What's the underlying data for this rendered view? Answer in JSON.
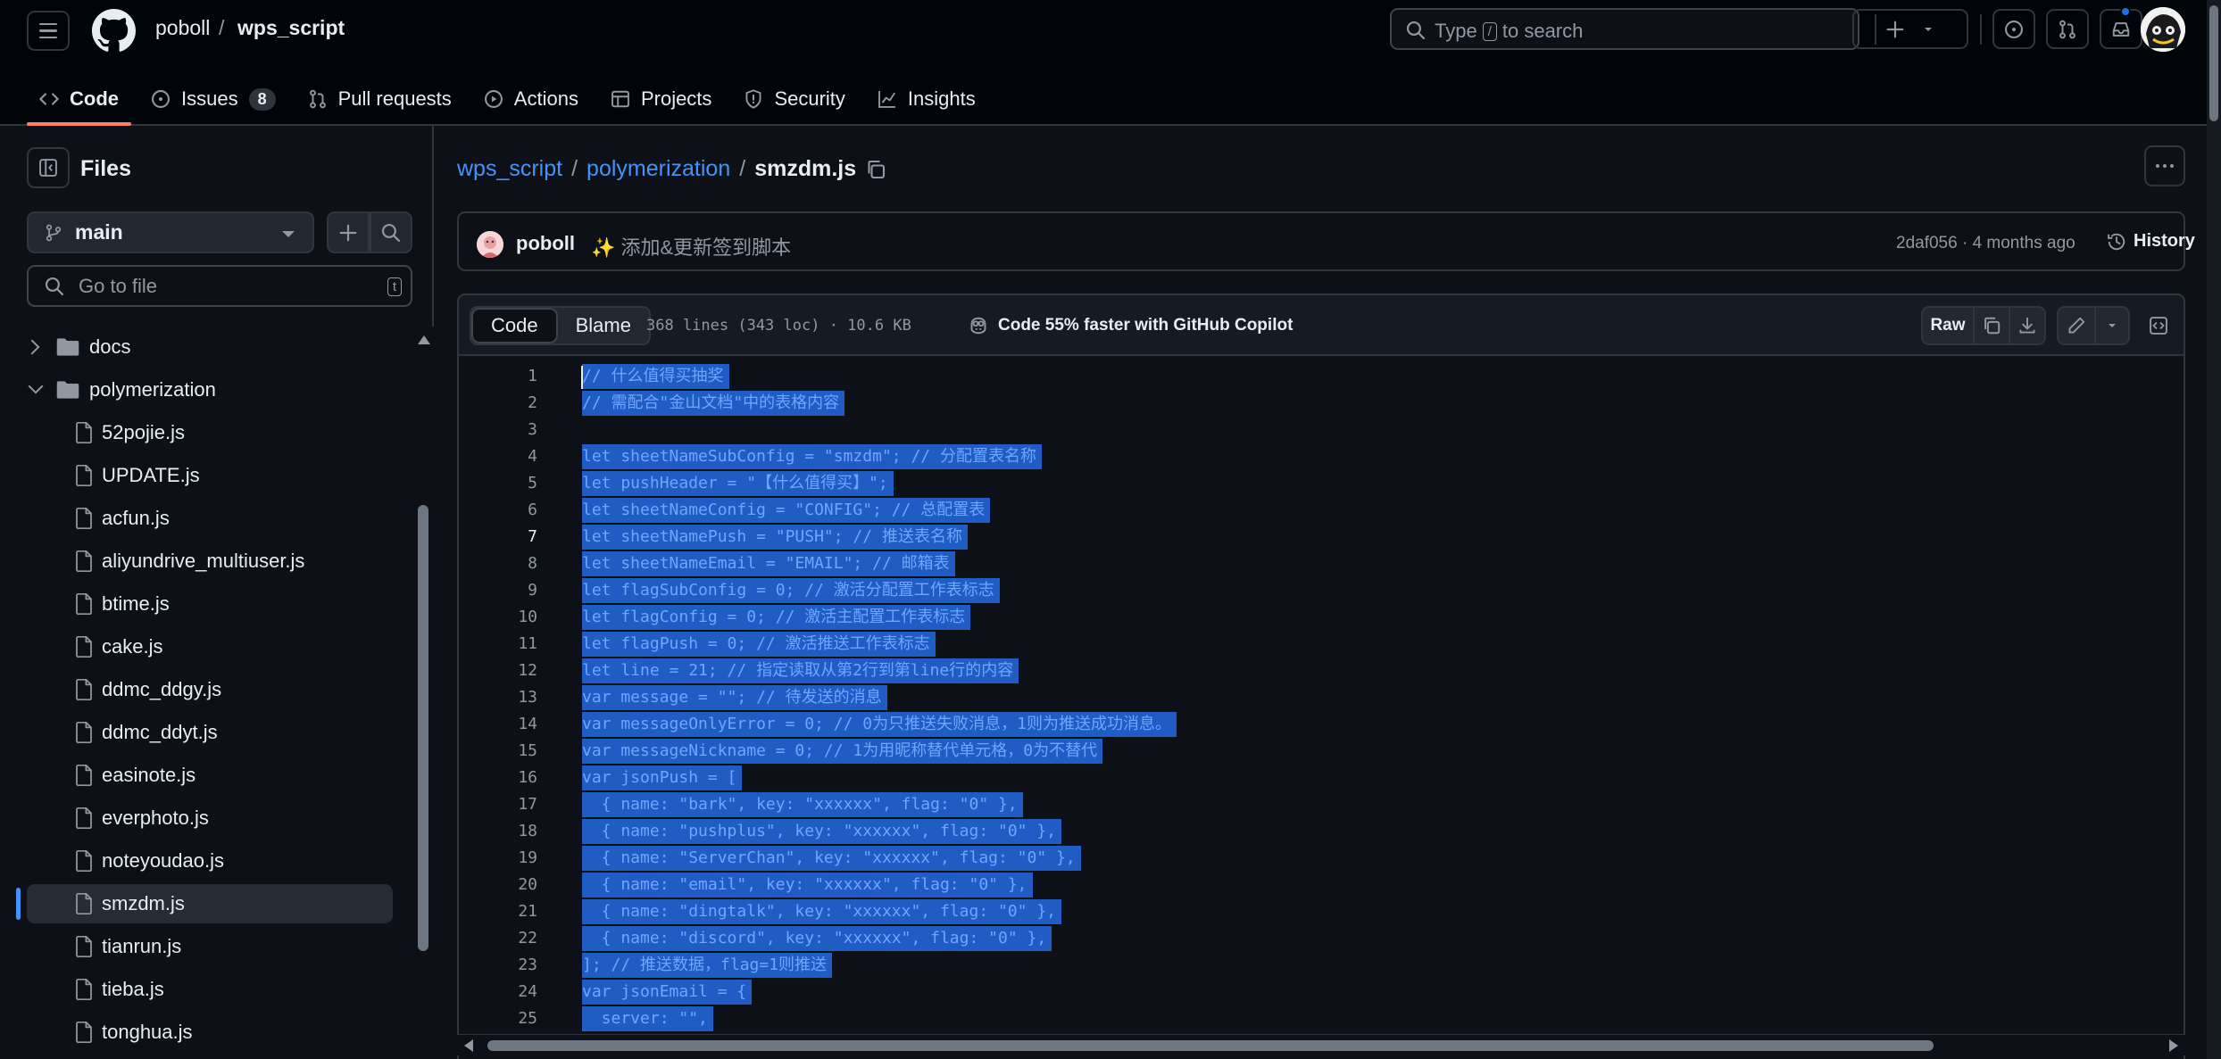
{
  "header": {
    "owner": "poboll",
    "separator": "/",
    "repo": "wps_script",
    "search": {
      "prefix": "Type",
      "key": "/",
      "suffix": "to search"
    }
  },
  "tabs": [
    {
      "label": "Code",
      "active": true,
      "icon": "code-icon"
    },
    {
      "label": "Issues",
      "counter": "8",
      "icon": "issue-icon"
    },
    {
      "label": "Pull requests",
      "icon": "pull-request-icon"
    },
    {
      "label": "Actions",
      "icon": "play-icon"
    },
    {
      "label": "Projects",
      "icon": "table-icon"
    },
    {
      "label": "Security",
      "icon": "shield-icon"
    },
    {
      "label": "Insights",
      "icon": "graph-icon"
    }
  ],
  "sidebar": {
    "title": "Files",
    "branch": "main",
    "goto_placeholder": "Go to file",
    "goto_key": "t",
    "tree": [
      {
        "name": "docs",
        "type": "folder",
        "expanded": false,
        "depth": 0
      },
      {
        "name": "polymerization",
        "type": "folder",
        "expanded": true,
        "depth": 0
      },
      {
        "name": "52pojie.js",
        "type": "file",
        "depth": 1
      },
      {
        "name": "UPDATE.js",
        "type": "file",
        "depth": 1
      },
      {
        "name": "acfun.js",
        "type": "file",
        "depth": 1
      },
      {
        "name": "aliyundrive_multiuser.js",
        "type": "file",
        "depth": 1
      },
      {
        "name": "btime.js",
        "type": "file",
        "depth": 1
      },
      {
        "name": "cake.js",
        "type": "file",
        "depth": 1
      },
      {
        "name": "ddmc_ddgy.js",
        "type": "file",
        "depth": 1
      },
      {
        "name": "ddmc_ddyt.js",
        "type": "file",
        "depth": 1
      },
      {
        "name": "easinote.js",
        "type": "file",
        "depth": 1
      },
      {
        "name": "everphoto.js",
        "type": "file",
        "depth": 1
      },
      {
        "name": "noteyoudao.js",
        "type": "file",
        "depth": 1
      },
      {
        "name": "smzdm.js",
        "type": "file",
        "depth": 1,
        "selected": true
      },
      {
        "name": "tianrun.js",
        "type": "file",
        "depth": 1
      },
      {
        "name": "tieba.js",
        "type": "file",
        "depth": 1
      },
      {
        "name": "tonghua.js",
        "type": "file",
        "depth": 1
      }
    ]
  },
  "main": {
    "path": {
      "repo": "wps_script",
      "folder": "polymerization",
      "file": "smzdm.js",
      "sep": "/"
    },
    "commit": {
      "author": "poboll",
      "message": "✨ 添加&更新签到脚本",
      "meta": "2daf056 · 4 months ago",
      "history": "History"
    },
    "file_header": {
      "code_tab": "Code",
      "blame_tab": "Blame",
      "meta": "368 lines (343 loc) · 10.6 KB",
      "copilot": "Code 55% faster with GitHub Copilot",
      "raw": "Raw"
    },
    "code": [
      {
        "n": "1",
        "t": "// 什么值得买抽奖"
      },
      {
        "n": "2",
        "t": "// 需配合\"金山文档\"中的表格内容"
      },
      {
        "n": "3",
        "t": ""
      },
      {
        "n": "4",
        "t": "let sheetNameSubConfig = \"smzdm\"; // 分配置表名称"
      },
      {
        "n": "5",
        "t": "let pushHeader = \"【什么值得买】\";"
      },
      {
        "n": "6",
        "t": "let sheetNameConfig = \"CONFIG\"; // 总配置表"
      },
      {
        "n": "7",
        "t": "let sheetNamePush = \"PUSH\"; // 推送表名称",
        "hot": true
      },
      {
        "n": "8",
        "t": "let sheetNameEmail = \"EMAIL\"; // 邮箱表"
      },
      {
        "n": "9",
        "t": "let flagSubConfig = 0; // 激活分配置工作表标志"
      },
      {
        "n": "10",
        "t": "let flagConfig = 0; // 激活主配置工作表标志"
      },
      {
        "n": "11",
        "t": "let flagPush = 0; // 激活推送工作表标志"
      },
      {
        "n": "12",
        "t": "let line = 21; // 指定读取从第2行到第line行的内容"
      },
      {
        "n": "13",
        "t": "var message = \"\"; // 待发送的消息"
      },
      {
        "n": "14",
        "t": "var messageOnlyError = 0; // 0为只推送失败消息，1则为推送成功消息。"
      },
      {
        "n": "15",
        "t": "var messageNickname = 0; // 1为用昵称替代单元格，0为不替代"
      },
      {
        "n": "16",
        "t": "var jsonPush = ["
      },
      {
        "n": "17",
        "t": "  { name: \"bark\", key: \"xxxxxx\", flag: \"0\" },"
      },
      {
        "n": "18",
        "t": "  { name: \"pushplus\", key: \"xxxxxx\", flag: \"0\" },"
      },
      {
        "n": "19",
        "t": "  { name: \"ServerChan\", key: \"xxxxxx\", flag: \"0\" },"
      },
      {
        "n": "20",
        "t": "  { name: \"email\", key: \"xxxxxx\", flag: \"0\" },"
      },
      {
        "n": "21",
        "t": "  { name: \"dingtalk\", key: \"xxxxxx\", flag: \"0\" },"
      },
      {
        "n": "22",
        "t": "  { name: \"discord\", key: \"xxxxxx\", flag: \"0\" },"
      },
      {
        "n": "23",
        "t": "]; // 推送数据，flag=1则推送"
      },
      {
        "n": "24",
        "t": "var jsonEmail = {"
      },
      {
        "n": "25",
        "t": "  server: \"\","
      }
    ]
  },
  "colors": {
    "bg": "#0d1117",
    "header_bg": "#010409",
    "border": "#30363d",
    "link": "#4493f8",
    "tab_underline": "#f78166",
    "selection": "#1f5dc4"
  }
}
